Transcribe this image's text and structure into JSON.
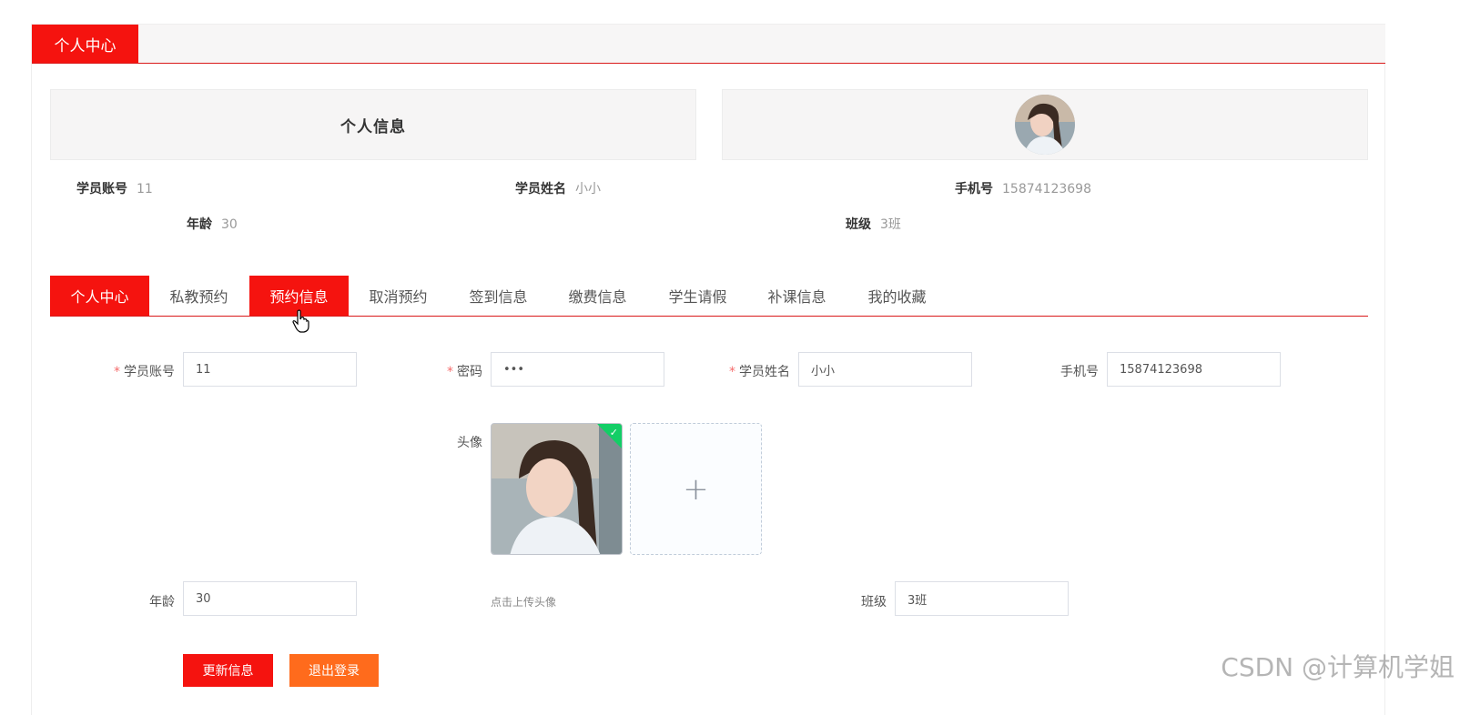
{
  "header": {
    "tab_label": "个人中心"
  },
  "profile": {
    "title": "个人信息",
    "fields": [
      {
        "label": "学员账号",
        "value": "11"
      },
      {
        "label": "学员姓名",
        "value": "小小"
      },
      {
        "label": "手机号",
        "value": "15874123698"
      },
      {
        "label": "年龄",
        "value": "30"
      },
      {
        "label": "班级",
        "value": "3班"
      }
    ]
  },
  "tabs": [
    "个人中心",
    "私教预约",
    "预约信息",
    "取消预约",
    "签到信息",
    "缴费信息",
    "学生请假",
    "补课信息",
    "我的收藏"
  ],
  "form": {
    "account": {
      "label": "学员账号",
      "value": "11"
    },
    "password": {
      "label": "密码",
      "value": "•••"
    },
    "name": {
      "label": "学员姓名",
      "value": "小小"
    },
    "phone": {
      "label": "手机号",
      "value": "15874123698"
    },
    "avatar": {
      "label": "头像",
      "hint": "点击上传头像",
      "add_symbol": "+"
    },
    "age": {
      "label": "年龄",
      "value": "30"
    },
    "class": {
      "label": "班级",
      "value": "3班"
    },
    "required_mark": "*"
  },
  "buttons": {
    "update": "更新信息",
    "logout": "退出登录"
  },
  "watermark": "CSDN @计算机学姐",
  "colors": {
    "primary": "#f5130f",
    "secondary": "#ff6b1c",
    "success": "#13ce66"
  }
}
